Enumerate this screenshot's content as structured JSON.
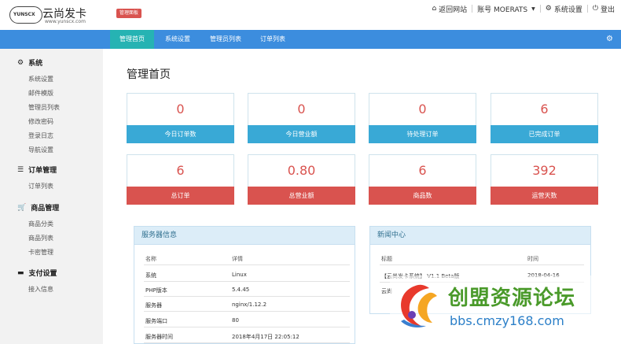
{
  "brand": {
    "logo_text": "YUNSCX",
    "title": "云尚发卡",
    "url": "www.yunscx.com",
    "badge": "管理面板"
  },
  "topnav": {
    "home_label": "返回网站",
    "account_label": "账号 MOERATS",
    "settings_label": "系统设置",
    "logout_label": "登出"
  },
  "mainnav": {
    "tabs": [
      {
        "label": "管理首页",
        "active": true
      },
      {
        "label": "系统设置",
        "active": false
      },
      {
        "label": "管理员列表",
        "active": false
      },
      {
        "label": "订单列表",
        "active": false
      }
    ]
  },
  "sidebar": {
    "groups": [
      {
        "title": "系统",
        "icon": "gear-icon",
        "items": [
          "系统设置",
          "邮件模版",
          "管理员列表",
          "修改密码",
          "登录日志",
          "导航设置"
        ]
      },
      {
        "title": "订单管理",
        "icon": "list-icon",
        "items": [
          "订单列表"
        ]
      },
      {
        "title": "商品管理",
        "icon": "cart-icon",
        "items": [
          "商品分类",
          "商品列表",
          "卡密管理"
        ]
      },
      {
        "title": "支付设置",
        "icon": "card-icon",
        "items": [
          "接入信息"
        ]
      }
    ]
  },
  "main": {
    "title": "管理首页",
    "stats": [
      {
        "value": "0",
        "label": "今日订单数",
        "color": "blue"
      },
      {
        "value": "0",
        "label": "今日营业额",
        "color": "blue"
      },
      {
        "value": "0",
        "label": "待处理订单",
        "color": "blue"
      },
      {
        "value": "6",
        "label": "已完成订单",
        "color": "blue"
      },
      {
        "value": "6",
        "label": "总订单",
        "color": "red"
      },
      {
        "value": "0.80",
        "label": "总营业额",
        "color": "red"
      },
      {
        "value": "6",
        "label": "商品数",
        "color": "red"
      },
      {
        "value": "392",
        "label": "运营天数",
        "color": "red"
      }
    ]
  },
  "server_panel": {
    "title": "服务器信息",
    "columns": [
      "名称",
      "详情"
    ],
    "rows": [
      [
        "系统",
        "Linux"
      ],
      [
        "PHP版本",
        "5.4.45"
      ],
      [
        "服务器",
        "nginx/1.12.2"
      ],
      [
        "服务端口",
        "80"
      ],
      [
        "服务器时间",
        "2018年4月17日 22:05:12"
      ]
    ]
  },
  "news_panel": {
    "title": "新闻中心",
    "columns": [
      "标题",
      "时间"
    ],
    "rows": [
      [
        "【云尚发卡系统】 V1.1 Beta版",
        "2018-04-16"
      ],
      [
        "云尚",
        ""
      ]
    ]
  },
  "watermark": {
    "title": "创盟资源论坛",
    "url": "bbs.cmzy168.com"
  },
  "colors": {
    "nav_blue": "#3c8dde",
    "active_tab": "#26b3b3",
    "card_blue": "#39a9d6",
    "card_red": "#d9534f",
    "value_red": "#d9534f"
  }
}
